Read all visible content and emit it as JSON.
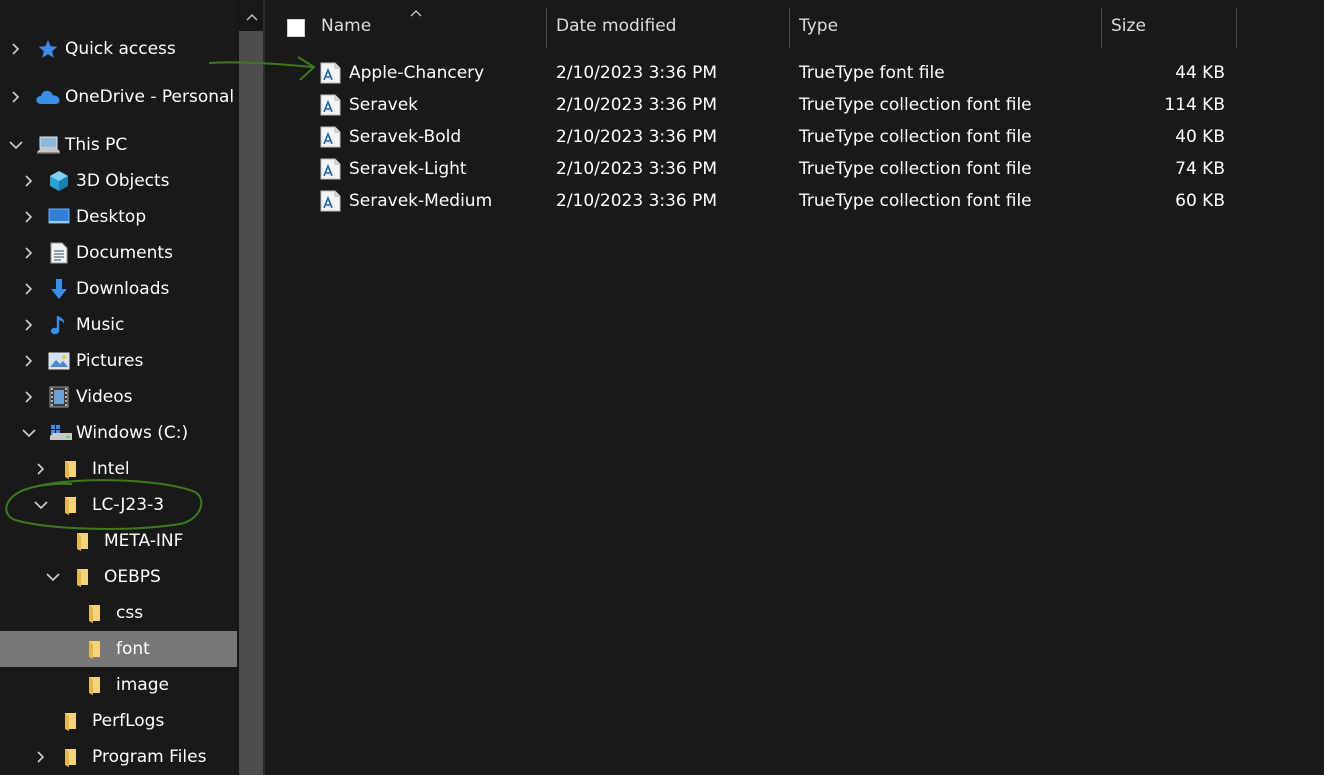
{
  "nav": {
    "items": [
      {
        "label": "Quick access",
        "icon": "star-icon",
        "expand": "collapsed",
        "level": 0
      },
      {
        "label": "OneDrive - Personal",
        "icon": "cloud-icon",
        "expand": "collapsed",
        "level": 0
      },
      {
        "label": "This PC",
        "icon": "computer-icon",
        "expand": "expanded",
        "level": 0
      },
      {
        "label": "3D Objects",
        "icon": "cube-icon",
        "expand": "collapsed",
        "level": 1
      },
      {
        "label": "Desktop",
        "icon": "desktop-icon",
        "expand": "collapsed",
        "level": 1
      },
      {
        "label": "Documents",
        "icon": "document-icon",
        "expand": "collapsed",
        "level": 1
      },
      {
        "label": "Downloads",
        "icon": "download-icon",
        "expand": "collapsed",
        "level": 1
      },
      {
        "label": "Music",
        "icon": "music-icon",
        "expand": "collapsed",
        "level": 1
      },
      {
        "label": "Pictures",
        "icon": "pictures-icon",
        "expand": "collapsed",
        "level": 1
      },
      {
        "label": "Videos",
        "icon": "videos-icon",
        "expand": "collapsed",
        "level": 1
      },
      {
        "label": "Windows (C:)",
        "icon": "drive-icon",
        "expand": "expanded",
        "level": 1
      },
      {
        "label": "Intel",
        "icon": "folder-icon",
        "expand": "collapsed",
        "level": 2
      },
      {
        "label": "LC-J23-3",
        "icon": "folder-icon",
        "expand": "expanded",
        "level": 2
      },
      {
        "label": "META-INF",
        "icon": "folder-icon",
        "expand": "none",
        "level": 3
      },
      {
        "label": "OEBPS",
        "icon": "folder-icon",
        "expand": "expanded",
        "level": 3
      },
      {
        "label": "css",
        "icon": "folder-icon",
        "expand": "none",
        "level": 4
      },
      {
        "label": "font",
        "icon": "folder-icon",
        "expand": "none",
        "level": 4,
        "selected": true
      },
      {
        "label": "image",
        "icon": "folder-icon",
        "expand": "none",
        "level": 4
      },
      {
        "label": "PerfLogs",
        "icon": "folder-icon",
        "expand": "none",
        "level": 2
      },
      {
        "label": "Program Files",
        "icon": "folder-icon",
        "expand": "collapsed",
        "level": 2
      }
    ]
  },
  "columns": {
    "name": "Name",
    "date": "Date modified",
    "type": "Type",
    "size": "Size"
  },
  "files": [
    {
      "name": "Apple-Chancery",
      "date": "2/10/2023 3:36 PM",
      "type": "TrueType font file",
      "size": "44 KB",
      "icon": "font-file-icon"
    },
    {
      "name": "Seravek",
      "date": "2/10/2023 3:36 PM",
      "type": "TrueType collection font file",
      "size": "114 KB",
      "icon": "font-file-icon"
    },
    {
      "name": "Seravek-Bold",
      "date": "2/10/2023 3:36 PM",
      "type": "TrueType collection font file",
      "size": "40 KB",
      "icon": "font-file-icon"
    },
    {
      "name": "Seravek-Light",
      "date": "2/10/2023 3:36 PM",
      "type": "TrueType collection font file",
      "size": "74 KB",
      "icon": "font-file-icon"
    },
    {
      "name": "Seravek-Medium",
      "date": "2/10/2023 3:36 PM",
      "type": "TrueType collection font file",
      "size": "60 KB",
      "icon": "font-file-icon"
    }
  ],
  "colors": {
    "background": "#191919",
    "selected_row": "#777777",
    "annotation": "#3d7a1d",
    "folder": "#f6d27a",
    "accent": "#3b8ee6"
  }
}
